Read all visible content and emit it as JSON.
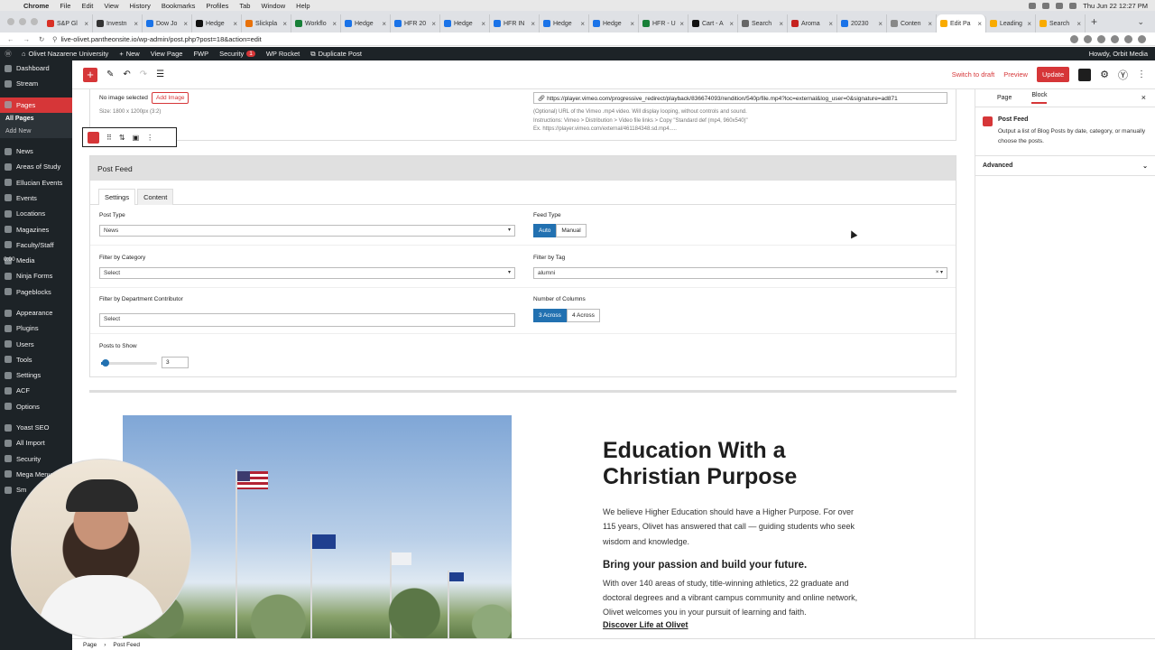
{
  "macmenu": {
    "app": "Chrome",
    "items": [
      "File",
      "Edit",
      "View",
      "History",
      "Bookmarks",
      "Profiles",
      "Tab",
      "Window",
      "Help"
    ],
    "clock": "Thu Jun 22  12:27 PM"
  },
  "browser_tabs": [
    {
      "label": "S&P Gl",
      "color": "#d93025"
    },
    {
      "label": "Investn",
      "color": "#333333"
    },
    {
      "label": "Dow Jo",
      "color": "#1a73e8"
    },
    {
      "label": "Hedge",
      "color": "#111111"
    },
    {
      "label": "Slickpla",
      "color": "#e8710a"
    },
    {
      "label": "Workflo",
      "color": "#188038"
    },
    {
      "label": "Hedge",
      "color": "#1a73e8"
    },
    {
      "label": "HFR 20",
      "color": "#1a73e8"
    },
    {
      "label": "Hedge",
      "color": "#1a73e8"
    },
    {
      "label": "HFR IN",
      "color": "#1a73e8"
    },
    {
      "label": "Hedge",
      "color": "#1a73e8"
    },
    {
      "label": "Hedge",
      "color": "#1a73e8"
    },
    {
      "label": "HFR - U",
      "color": "#188038"
    },
    {
      "label": "Cart - A",
      "color": "#111111"
    },
    {
      "label": "Search",
      "color": "#666666"
    },
    {
      "label": "Aroma",
      "color": "#c5221f"
    },
    {
      "label": "20230",
      "color": "#1a73e8"
    },
    {
      "label": "Conten",
      "color": "#888888"
    },
    {
      "label": "Edit Pa",
      "color": "#f9ab00",
      "active": true
    },
    {
      "label": "Leading",
      "color": "#f9ab00"
    },
    {
      "label": "Search",
      "color": "#f9ab00"
    }
  ],
  "address_url": "live-olivet.pantheonsite.io/wp-admin/post.php?post=18&action=edit",
  "wp_toolbar": {
    "site": "Olivet Nazarene University",
    "new": "New",
    "view": "View Page",
    "fwp": "FWP",
    "security": "Security",
    "security_count": "1",
    "rocket": "WP Rocket",
    "duplicate": "Duplicate Post",
    "howdy": "Howdy, Orbit Media"
  },
  "admin_menu": [
    {
      "label": "Dashboard"
    },
    {
      "label": "Stream"
    },
    {
      "sep": true
    },
    {
      "label": "Pages",
      "current": true
    },
    {
      "label": "All Pages",
      "sub": true,
      "cur": true
    },
    {
      "label": "Add New",
      "sub": true
    },
    {
      "sep": true
    },
    {
      "label": "News"
    },
    {
      "label": "Areas of Study"
    },
    {
      "label": "Ellucian Events"
    },
    {
      "label": "Events"
    },
    {
      "label": "Locations"
    },
    {
      "label": "Magazines"
    },
    {
      "label": "Faculty/Staff"
    },
    {
      "label": "Media"
    },
    {
      "label": "Ninja Forms"
    },
    {
      "label": "Pageblocks"
    },
    {
      "sep": true
    },
    {
      "label": "Appearance"
    },
    {
      "label": "Plugins"
    },
    {
      "label": "Users"
    },
    {
      "label": "Tools"
    },
    {
      "label": "Settings"
    },
    {
      "label": "ACF"
    },
    {
      "label": "Options"
    },
    {
      "sep": true
    },
    {
      "label": "Yoast SEO"
    },
    {
      "label": "All Import"
    },
    {
      "label": "Security"
    },
    {
      "label": "Mega Menu"
    },
    {
      "label": "Sm"
    }
  ],
  "timer": "0:00",
  "editor_toolbar": {
    "switch_draft": "Switch to draft",
    "preview": "Preview",
    "update": "Update"
  },
  "video_block": {
    "no_image": "No image selected",
    "add_image": "Add Image",
    "size": "Size: 1800 x 1200px (3:2)",
    "url_value": "https://player.vimeo.com/progressive_redirect/playback/836674093/rendition/540p/file.mp4?loc=external&log_user=0&signature=ad871",
    "help1": "(Optional) URL of the Vimeo .mp4 video. Will display looping, without controls and sound.",
    "help2": "Instructions: Vimeo > Distribution > Video file links > Copy \"Standard def (mp4, 960x540)\"",
    "help3": "Ex. https://player.vimeo.com/external/461184348.sd.mp4....."
  },
  "post_feed": {
    "title": "Post Feed",
    "tabs": [
      "Settings",
      "Content"
    ],
    "post_type_label": "Post Type",
    "post_type_value": "News",
    "feed_type_label": "Feed Type",
    "feed_auto": "Auto",
    "feed_manual": "Manual",
    "filter_cat_label": "Filter by Category",
    "filter_cat_value": "Select",
    "filter_tag_label": "Filter by Tag",
    "filter_tag_value": "alumni",
    "filter_dept_label": "Filter by Department Contributor",
    "filter_dept_value": "Select",
    "columns_label": "Number of Columns",
    "col_3": "3 Across",
    "col_4": "4 Across",
    "posts_label": "Posts to Show",
    "posts_value": "3",
    "posts_slider_fraction": 0.08
  },
  "hero": {
    "title": "Education With a Christian Purpose",
    "p1": "We believe Higher Education should have a Higher Purpose. For over 115 years, Olivet has answered that call — guiding students who seek wisdom and knowledge.",
    "sub": "Bring your passion and build your future.",
    "p2": "With over 140 areas of study, title-winning athletics, 22 graduate and doctoral degrees and a vibrant campus community and online network, Olivet welcomes you in your pursuit of learning and faith.",
    "link": "Discover Life at Olivet"
  },
  "sidebar": {
    "tab_page": "Page",
    "tab_block": "Block",
    "block_title": "Post Feed",
    "block_desc": "Output a list of Blog Posts by date, category, or manually choose the posts.",
    "advanced": "Advanced"
  },
  "footer": {
    "crumb1": "Page",
    "crumb2": "Post Feed"
  }
}
